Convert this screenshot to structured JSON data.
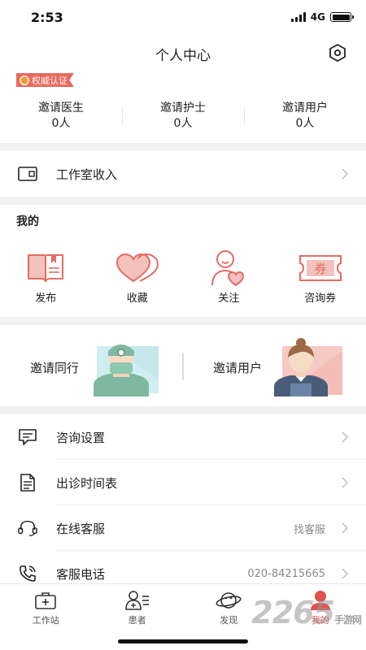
{
  "status_bar": {
    "time": "2:53",
    "network": "4G"
  },
  "header": {
    "title": "个人中心",
    "settings_icon": "settings-hexagon-icon"
  },
  "badge": {
    "label": "权威认证",
    "medal_glyph": "证"
  },
  "stats": [
    {
      "label": "邀请医生",
      "value": "0人"
    },
    {
      "label": "邀请护士",
      "value": "0人"
    },
    {
      "label": "邀请用户",
      "value": "0人"
    }
  ],
  "income_row": {
    "label": "工作室收入",
    "icon": "wallet-icon"
  },
  "my_section": {
    "title": "我的",
    "items": [
      {
        "label": "发布",
        "icon": "publish-book-icon"
      },
      {
        "label": "收藏",
        "icon": "heart-icon"
      },
      {
        "label": "关注",
        "icon": "follow-person-heart-icon"
      },
      {
        "label": "咨询券",
        "icon": "coupon-icon",
        "glyph": "券"
      }
    ]
  },
  "invite": {
    "colleague_label": "邀请同行",
    "user_label": "邀请用户"
  },
  "menu": [
    {
      "label": "咨询设置",
      "icon": "chat-settings-icon",
      "value": ""
    },
    {
      "label": "出诊时间表",
      "icon": "schedule-document-icon",
      "value": ""
    },
    {
      "label": "在线客服",
      "icon": "headset-icon",
      "value": "找客服"
    },
    {
      "label": "客服电话",
      "icon": "phone-icon",
      "value": "020-84215665"
    }
  ],
  "tabs": [
    {
      "label": "工作站",
      "icon": "medical-kit-icon",
      "active": false
    },
    {
      "label": "患者",
      "icon": "patient-list-icon",
      "active": false
    },
    {
      "label": "发现",
      "icon": "planet-icon",
      "active": false
    },
    {
      "label": "我的",
      "icon": "profile-icon",
      "active": true
    }
  ],
  "watermark": {
    "text": "2265",
    "sub": "手游网"
  },
  "colors": {
    "accent": "#e0524c",
    "icon_red": "#e46a62",
    "badge": "#e86a5f",
    "gap": "#f2f2f2"
  }
}
